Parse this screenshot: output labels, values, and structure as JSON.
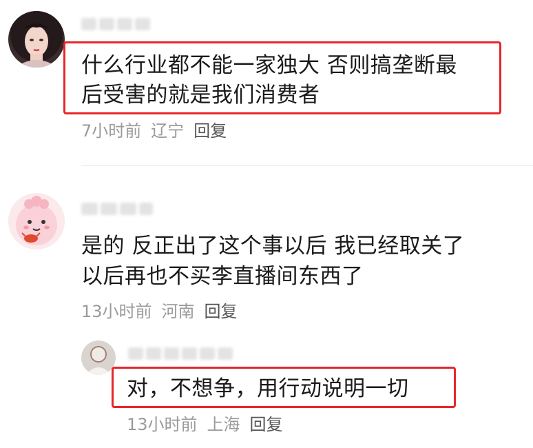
{
  "colors": {
    "highlight": "#e8262a",
    "meta_text": "#9a9a9a",
    "reply_text": "#555555"
  },
  "comments": [
    {
      "avatar_icon": "female-character-avatar",
      "text_line1": "什么行业都不能一家独大 否则搞垄断最",
      "text_line2": "后受害的就是我们消费者",
      "time": "7小时前",
      "location": "辽宁",
      "reply_label": "回复"
    },
    {
      "avatar_icon": "pink-cartoon-avatar",
      "text_line1": "是的 反正出了这个事以后 我已经取关了",
      "text_line2": "以后再也不买李直播间东西了",
      "time": "13小时前",
      "location": "河南",
      "reply_label": "回复",
      "reply": {
        "avatar_icon": "user-photo-avatar",
        "text": "对，不想争，用行动说明一切",
        "time": "13小时前",
        "location": "上海",
        "reply_label": "回复"
      }
    }
  ]
}
